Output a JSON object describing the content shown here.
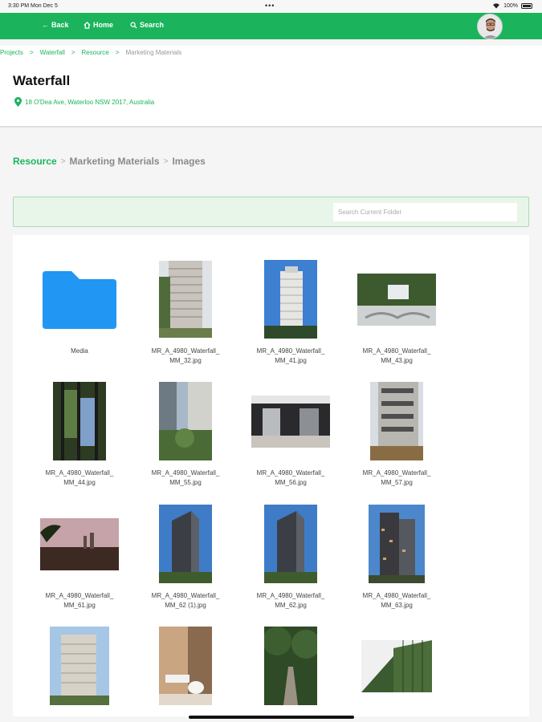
{
  "status_bar": {
    "time": "3:30 PM  Mon Dec 5",
    "battery": "100%"
  },
  "nav": {
    "back_label": "Back",
    "home_label": "Home",
    "search_label": "Search"
  },
  "breadcrumb": {
    "projects": "Projects",
    "waterfall": "Waterfall",
    "resource": "Resource",
    "current": "Marketing Materials"
  },
  "project": {
    "title": "Waterfall",
    "address": "18 O'Dea Ave, Waterloo NSW 2017, Australia"
  },
  "folder_path": {
    "root": "Resource",
    "level1": "Marketing Materials",
    "level2": "Images"
  },
  "search": {
    "placeholder": "Search Current Folder",
    "value": ""
  },
  "colors": {
    "brand_green": "#1bb45c",
    "folder_blue": "#2196f3"
  },
  "files": [
    {
      "name": "Media",
      "kind": "folder"
    },
    {
      "line1": "MR_A_4980_Waterfall_",
      "line2": "MM_32.jpg",
      "kind": "image"
    },
    {
      "line1": "MR_A_4980_Waterfall_",
      "line2": "MM_41.jpg",
      "kind": "image"
    },
    {
      "line1": "MR_A_4980_Waterfall_",
      "line2": "MM_43.jpg",
      "kind": "image"
    },
    {
      "line1": "MR_A_4980_Waterfall_",
      "line2": "MM_44.jpg",
      "kind": "image"
    },
    {
      "line1": "MR_A_4980_Waterfall_",
      "line2": "MM_55.jpg",
      "kind": "image"
    },
    {
      "line1": "MR_A_4980_Waterfall_",
      "line2": "MM_56.jpg",
      "kind": "image"
    },
    {
      "line1": "MR_A_4980_Waterfall_",
      "line2": "MM_57.jpg",
      "kind": "image"
    },
    {
      "line1": "MR_A_4980_Waterfall_",
      "line2": "MM_61.jpg",
      "kind": "image"
    },
    {
      "line1": "MR_A_4980_Waterfall_",
      "line2": "MM_62 (1).jpg",
      "kind": "image"
    },
    {
      "line1": "MR_A_4980_Waterfall_",
      "line2": "MM_62.jpg",
      "kind": "image"
    },
    {
      "line1": "MR_A_4980_Waterfall_",
      "line2": "MM_63.jpg",
      "kind": "image"
    },
    {
      "line1": "",
      "line2": "",
      "kind": "image"
    },
    {
      "line1": "",
      "line2": "",
      "kind": "image"
    },
    {
      "line1": "",
      "line2": "",
      "kind": "image"
    },
    {
      "line1": "",
      "line2": "",
      "kind": "image"
    }
  ]
}
